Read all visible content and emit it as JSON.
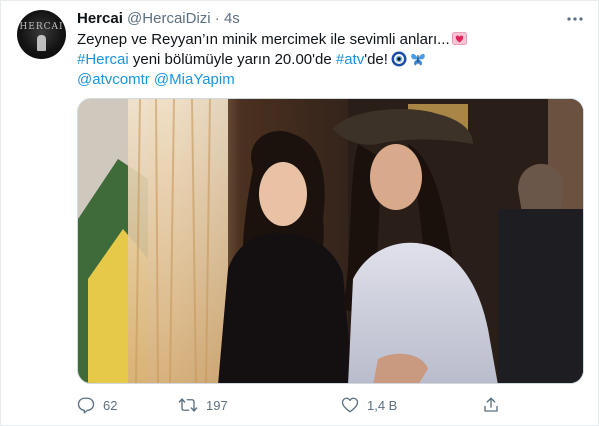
{
  "author": {
    "display_name": "Hercai",
    "handle": "@HercaiDizi",
    "separator": "·",
    "timestamp": "4s",
    "avatar_text": "HERCAI"
  },
  "tweet": {
    "line1": "Zeynep ve Reyyan’ın minik mercimek ile sevimli anları...",
    "line2_hashtag": "#Hercai",
    "line2_text": " yeni bölümüyle yarın 20.00'de ",
    "line2_hashtag2": "#atv",
    "line2_suffix": "'de!",
    "mention1": "@atvcomtr",
    "mention2": "@MiaYapim"
  },
  "actions": {
    "reply_count": "62",
    "retweet_count": "197",
    "like_count": "1,4 B"
  },
  "icons": {
    "more": "more-horizontal-icon",
    "reply": "reply-icon",
    "retweet": "retweet-icon",
    "like": "heart-icon",
    "share": "share-icon",
    "heart_emoji": "heart-with-ribbon-emoji",
    "eye_emoji": "nazar-amulet-emoji",
    "butterfly_emoji": "butterfly-emoji"
  },
  "colors": {
    "link": "#1b95e0",
    "text": "#0f1419",
    "secondary": "#5b7083",
    "border": "#cfd9de"
  }
}
